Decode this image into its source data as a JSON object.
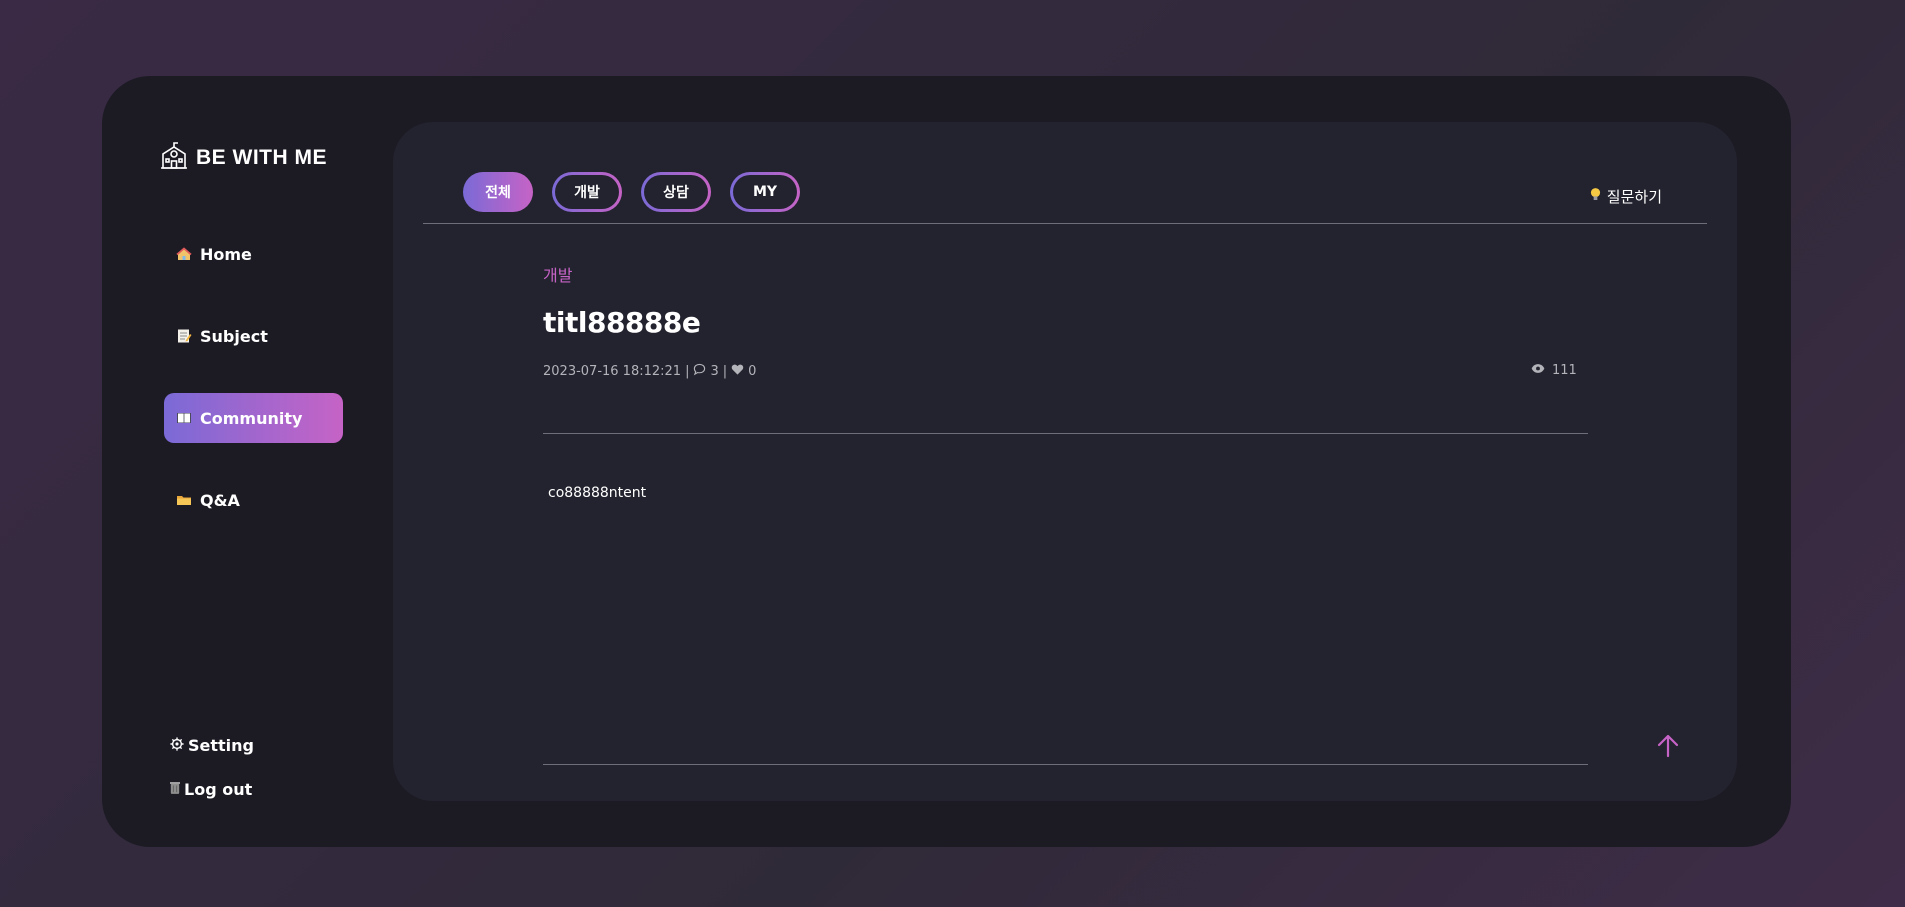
{
  "brand": {
    "name": "BE WITH ME",
    "icon": "school-building-icon"
  },
  "sidebar": {
    "items": [
      {
        "label": "Home",
        "icon": "house-icon",
        "active": false
      },
      {
        "label": "Subject",
        "icon": "memo-icon",
        "active": false
      },
      {
        "label": "Community",
        "icon": "open-book-icon",
        "active": true
      },
      {
        "label": "Q&A",
        "icon": "folder-icon",
        "active": false
      }
    ],
    "bottom": [
      {
        "label": "Setting",
        "icon": "gear-icon"
      },
      {
        "label": "Log out",
        "icon": "trash-can-icon"
      }
    ]
  },
  "tabs": [
    {
      "label": "전체",
      "active": true
    },
    {
      "label": "개발",
      "active": false
    },
    {
      "label": "상담",
      "active": false
    },
    {
      "label": "MY",
      "active": false
    }
  ],
  "ask_button": {
    "label": "질문하기",
    "icon": "lightbulb-icon"
  },
  "post": {
    "category": "개발",
    "title": "titl88888e",
    "date": "2023-07-16 18:12:21",
    "separator": "|",
    "comments": "3",
    "likes": "0",
    "views": "111",
    "content": "co88888ntent"
  },
  "colors": {
    "accent_start": "#7b6ad6",
    "accent_end": "#c663c6",
    "app_bg": "#1c1b24",
    "panel_bg": "#23232f"
  }
}
